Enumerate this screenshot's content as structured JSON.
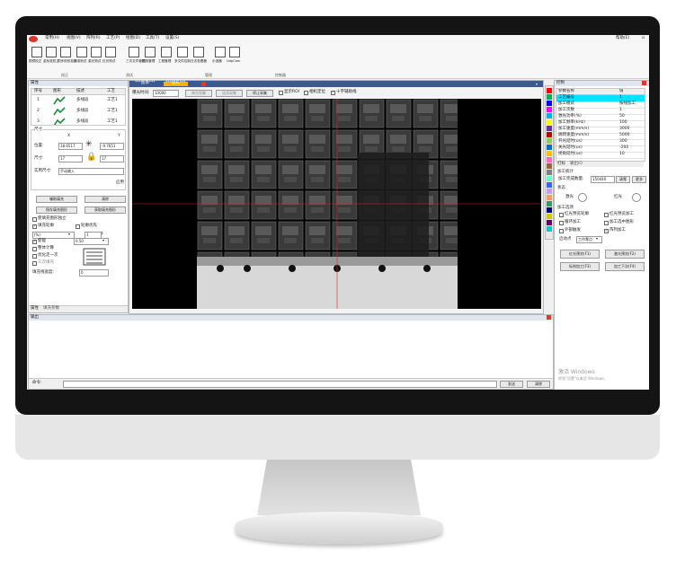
{
  "menu": {
    "items": [
      "常用(H)",
      "视图(V)",
      "阵列(R)",
      "工艺(P)",
      "绘图(D)",
      "工具(T)",
      "设置(S)"
    ],
    "help": "帮助(E)"
  },
  "ribbon": {
    "buttons": [
      "振镜校正",
      "金标准校正",
      "同步校校检查",
      "标准测试",
      "激光测试",
      "红光测试",
      "三次文件管理",
      "图档管理",
      "工程管理",
      "多文件控制",
      "日志查看器",
      "示波器",
      "UdpCom"
    ],
    "groups": [
      "校正",
      "测试",
      "管理",
      "控制器"
    ]
  },
  "left": {
    "title": "属性",
    "table_headers": [
      "序号",
      "图形",
      "描述",
      "工艺"
    ],
    "table_rows": [
      {
        "no": "1",
        "desc": "多线段",
        "proc": "工艺1"
      },
      {
        "no": "2",
        "desc": "多线段",
        "proc": "工艺1"
      },
      {
        "no": "3",
        "desc": "多线段",
        "proc": "工艺1"
      }
    ],
    "size_label": "尺寸",
    "x_label": "X",
    "y_label": "Y",
    "pos_label": "位置:",
    "pos_x": "18.6517",
    "pos_y": "-9.7651",
    "size_row_label": "尺寸:",
    "size_x": "17",
    "size_y": "17",
    "actual_label": "实用尺寸:",
    "actual_value": "手动输入",
    "apply_label": "应用",
    "btn_collect": "辅助填充",
    "btn_clear": "清除",
    "btn_save_fill": "保存填充图形",
    "btn_get_fill": "获取填充图形",
    "opt_keep": "使填充图形独立",
    "opt_wrap": "填充轮廓",
    "opt_first": "轮廓优先",
    "sel_a": "(%)",
    "sel_a_num": "1",
    "opt_enable": "使能",
    "sel_b": "0.50",
    "opt_offset": "整体计算",
    "opt_once": "优化走一次",
    "opt_3": "三次填充",
    "opt_count_label": "填充线宽度:",
    "opt_count": "0",
    "tabs": [
      "属性",
      "填充参数"
    ]
  },
  "camera": {
    "tabs": [
      "***图像***",
      "***相机***"
    ],
    "exposure_label": "曝光时间:",
    "exposure_value": "10000",
    "btn_single": "单次采集",
    "btn_cont": "连续采集",
    "btn_stop": "停止采集",
    "opt_roi": "显示ROI",
    "opt_locate": "相机定位",
    "opt_cross": "十字辅助线",
    "cross_checked": true
  },
  "right": {
    "title": "控制",
    "headers": [
      "参数名称",
      "值"
    ],
    "rows": [
      {
        "name": "工艺编号",
        "value": "1"
      },
      {
        "name": "加工模式",
        "value": "按线加工"
      },
      {
        "name": "加工次数",
        "value": "1"
      },
      {
        "name": "激光功率(%)",
        "value": "50"
      },
      {
        "name": "加工频率(kHz)",
        "value": "100"
      },
      {
        "name": "加工速度(mm/s)",
        "value": "3000"
      },
      {
        "name": "跳转速度(mm/s)",
        "value": "5000"
      },
      {
        "name": "开光延时(us)",
        "value": "300"
      },
      {
        "name": "关光延时(us)",
        "value": "-200"
      },
      {
        "name": "拐角延时(us)",
        "value": "10"
      }
    ],
    "tabs": [
      "打标",
      "输出IO"
    ],
    "count_title": "加工统计",
    "count_label": "加工完成数量:",
    "count_value": "150440",
    "btn_zero": "清零",
    "btn_more": "更多",
    "status_title": "状态",
    "status_laser": "激光",
    "status_red": "红光",
    "mode_title": "加工选项",
    "opt_red_frame": "红光预览轮廓",
    "opt_red_sim": "红光预览加工",
    "opt_loop": "循环加工",
    "opt_select": "加工选中图形",
    "opt_outer": "外部触发",
    "opt_array": "阵列加工",
    "array_checked": true,
    "start_label": "启动点",
    "start_value": "工作零点",
    "btn_red": "红光预览(F1)",
    "btn_red_sel": "激光预览(F2)",
    "btn_mark": "标刻加工(F3)",
    "btn_next": "加工下次(F4)",
    "activate_title": "激活 Windows",
    "activate_sub": "转到\"设置\"以激活 Windows。"
  },
  "bottom": {
    "title": "输出",
    "cmd_label": "命令:",
    "btn_send": "发送",
    "btn_clear": "清除"
  },
  "palette": [
    "#ff0000",
    "#00b050",
    "#0000ff",
    "#ff00ff",
    "#00b0f0",
    "#ffff00",
    "#7030a0",
    "#c00000",
    "#92d050",
    "#0070c0",
    "#ffc000",
    "#ff66cc",
    "#996633",
    "#808080",
    "#66ffcc",
    "#3366ff",
    "#cc99ff",
    "#ff9966",
    "#339966",
    "#000080",
    "#cccc00",
    "#660066",
    "#00cccc"
  ],
  "accent": "#2b79d6"
}
